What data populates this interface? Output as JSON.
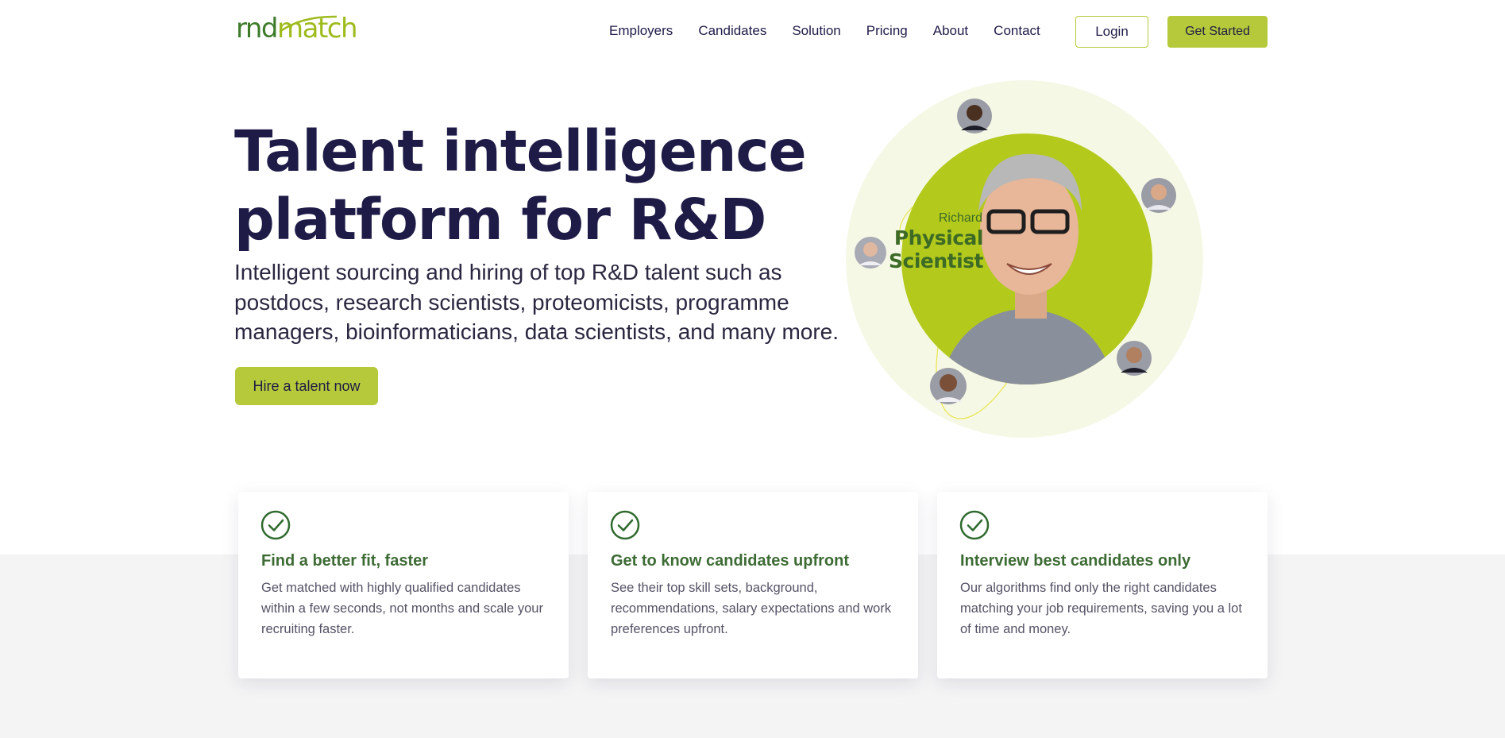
{
  "header": {
    "logo_part1": "rnd",
    "logo_part2": "match",
    "nav": [
      "Employers",
      "Candidates",
      "Solution",
      "Pricing",
      "About",
      "Contact"
    ],
    "login_label": "Login",
    "get_started_label": "Get Started"
  },
  "hero": {
    "title": "Talent intelligence platform for R&D",
    "subtitle": "Intelligent sourcing and hiring of top R&D talent such as postdocs, research scientists, proteomicists, programme managers, bioinformaticians, data scientists, and many more.",
    "cta_label": "Hire a talent now",
    "featured_name": "Richard",
    "featured_role": "Physical Scientist"
  },
  "features": [
    {
      "title": "Find a better fit, faster",
      "body": "Get matched with highly qualified candidates within a few seconds, not months and scale your recruiting faster."
    },
    {
      "title": "Get to know candidates upfront",
      "body": "See their top skill sets, background, recommendations, salary expectations and work preferences upfront."
    },
    {
      "title": "Interview best candidates only",
      "body": "Our algorithms find only the right candidates matching your job requirements, saving you a lot of time and money."
    }
  ],
  "colors": {
    "brand_green": "#b5c93a",
    "dark_green": "#3d6b34",
    "navy": "#1e1b47",
    "band_gray": "#f4f4f5"
  },
  "icons": [
    "check-circle-icon",
    "avatar-icon"
  ]
}
